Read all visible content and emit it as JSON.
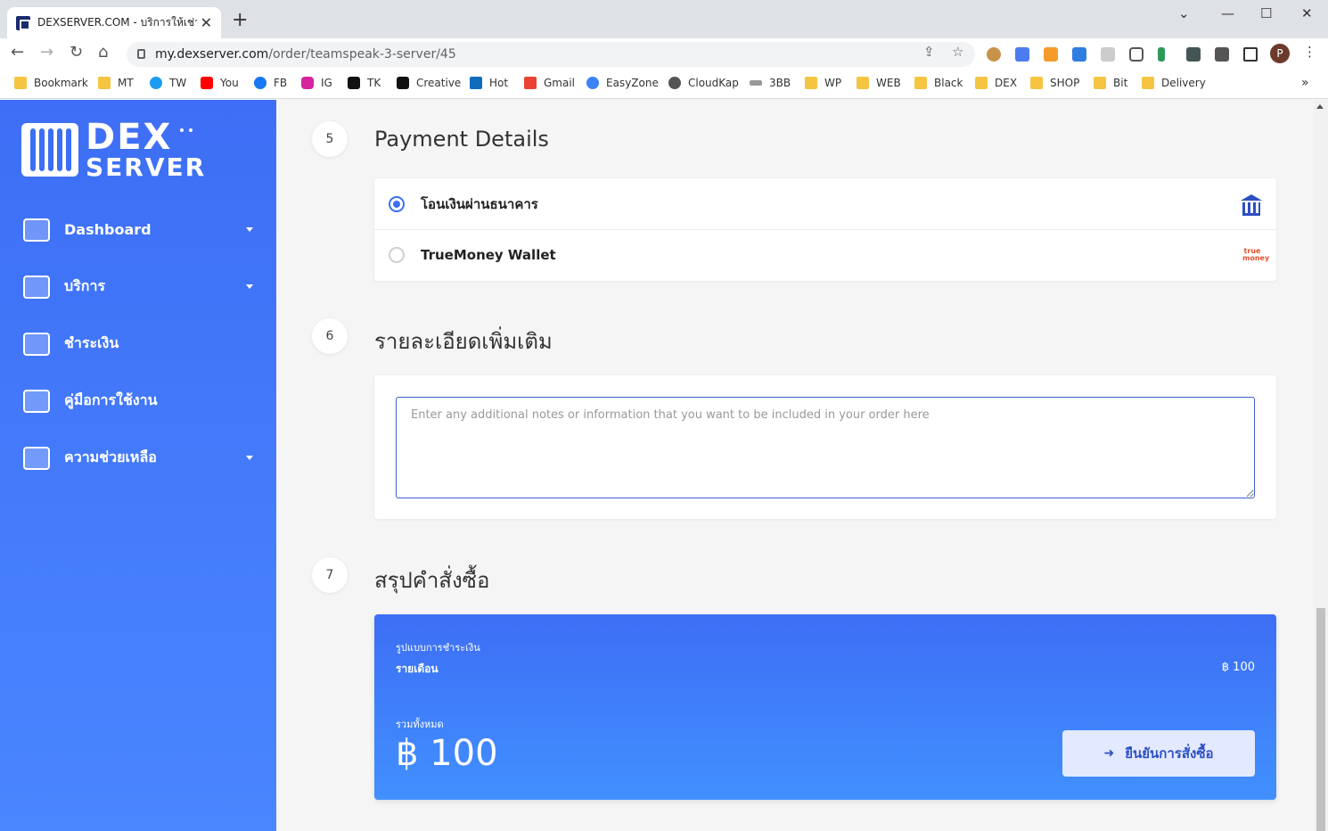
{
  "browser": {
    "tab_title": "DEXSERVER.COM - บริการให้เช่าและ",
    "tab_close": "✕",
    "new_tab": "+",
    "url_host": "my.dexserver.com",
    "url_path": "/order/teamspeak-3-server/45",
    "profile_initial": "P",
    "bookmarks": [
      {
        "label": "Bookmark",
        "icon": "folder-icon"
      },
      {
        "label": "MT",
        "icon": "folder-icon"
      },
      {
        "label": "TW",
        "icon": "twitter-icon"
      },
      {
        "label": "You",
        "icon": "youtube-icon"
      },
      {
        "label": "FB",
        "icon": "facebook-icon"
      },
      {
        "label": "IG",
        "icon": "instagram-icon"
      },
      {
        "label": "TK",
        "icon": "tiktok-icon"
      },
      {
        "label": "Creative",
        "icon": "tiktok-icon"
      },
      {
        "label": "Hot",
        "icon": "outlook-icon"
      },
      {
        "label": "Gmail",
        "icon": "gmail-icon"
      },
      {
        "label": "EasyZone",
        "icon": "cloud-icon"
      },
      {
        "label": "CloudKap",
        "icon": "globe-icon"
      },
      {
        "label": "3BB",
        "icon": "3bb-icon"
      },
      {
        "label": "WP",
        "icon": "folder-icon"
      },
      {
        "label": "WEB",
        "icon": "folder-icon"
      },
      {
        "label": "Black",
        "icon": "folder-icon"
      },
      {
        "label": "DEX",
        "icon": "folder-icon"
      },
      {
        "label": "SHOP",
        "icon": "folder-icon"
      },
      {
        "label": "Bit",
        "icon": "folder-icon"
      },
      {
        "label": "Delivery",
        "icon": "folder-icon"
      }
    ],
    "bookmarks_more": "»"
  },
  "sidebar": {
    "logo_line1": "DEX",
    "logo_line2": "SERVER",
    "items": [
      {
        "label": "Dashboard",
        "icon": "dashboard-icon",
        "has_caret": true
      },
      {
        "label": "บริการ",
        "icon": "services-icon",
        "has_caret": true
      },
      {
        "label": "ชำระเงิน",
        "icon": "payment-icon",
        "has_caret": false
      },
      {
        "label": "คู่มือการใช้งาน",
        "icon": "manual-icon",
        "has_caret": false
      },
      {
        "label": "ความช่วยเหลือ",
        "icon": "help-icon",
        "has_caret": true
      }
    ]
  },
  "steps": {
    "payment": {
      "number": "5",
      "title": "Payment Details"
    },
    "notes": {
      "number": "6",
      "title": "รายละเอียดเพิ่มเติม"
    },
    "summary": {
      "number": "7",
      "title": "สรุปคำสั่งซื้อ"
    }
  },
  "payment_methods": [
    {
      "label": "โอนเงินผ่านธนาคาร",
      "selected": true,
      "icon": "bank-icon"
    },
    {
      "label": "TrueMoney Wallet",
      "selected": false,
      "icon": "truemoney-icon",
      "icon_text": "true money"
    }
  ],
  "notes_field": {
    "value": "",
    "placeholder": "Enter any additional notes or information that you want to be included in your order here"
  },
  "order_summary": {
    "billing_label": "รูปแบบการชำระเงิน",
    "billing_cycle": "รายเดือน",
    "billing_price": "฿ 100",
    "total_label": "รวมทั้งหมด",
    "total": "฿ 100",
    "confirm_label": "ยืนยันการสั่งซื้อ",
    "confirm_icon": "➜"
  },
  "colors": {
    "brand": "#3d6ef5",
    "brand_light": "#4190ff",
    "button_bg": "#e3e9ff",
    "button_text": "#2d4fc4"
  }
}
